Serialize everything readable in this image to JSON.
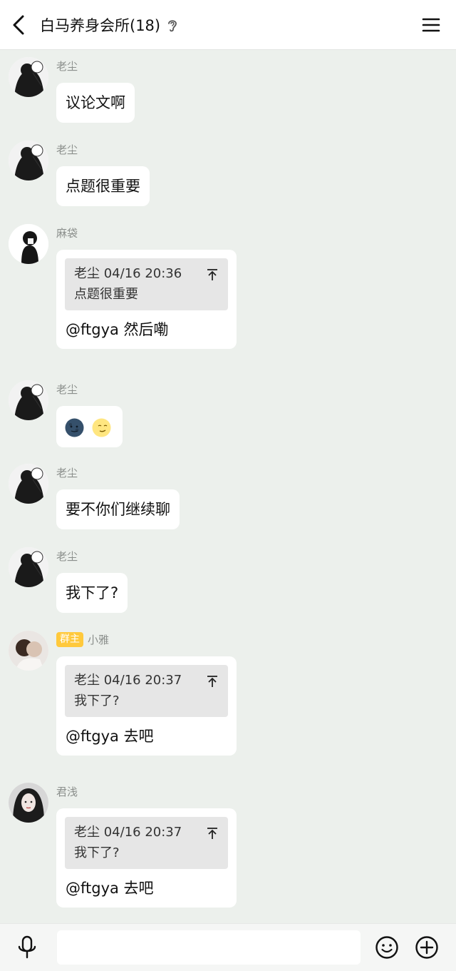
{
  "header": {
    "title": "白马养身会所(18)",
    "back_icon": "back-arrow-icon",
    "ear_icon": "ear-icon",
    "menu_icon": "menu-icon"
  },
  "messages": [
    {
      "sender": "老尘",
      "text": "议论文啊"
    },
    {
      "sender": "老尘",
      "text": "点题很重要"
    },
    {
      "sender": "麻袋",
      "quote_author": "老尘",
      "quote_time": "04/16 20:36",
      "quote_text": "点题很重要",
      "text": "@ftgya 然后嘞"
    },
    {
      "sender": "老尘",
      "emojis": [
        "new-moon-face-emoji",
        "first-quarter-moon-face-emoji"
      ]
    },
    {
      "sender": "老尘",
      "text": "要不你们继续聊"
    },
    {
      "sender": "老尘",
      "text": "我下了?"
    },
    {
      "sender": "小雅",
      "badge": "群主",
      "quote_author": "老尘",
      "quote_time": "04/16 20:37",
      "quote_text": "我下了?",
      "text": "@ftgya 去吧"
    },
    {
      "sender": "君浅",
      "quote_author": "老尘",
      "quote_time": "04/16 20:37",
      "quote_text": "我下了?",
      "text": "@ftgya 去吧"
    }
  ],
  "footer": {
    "input_value": "",
    "voice_icon": "microphone-icon",
    "emoji_icon": "smiley-icon",
    "plus_icon": "plus-circle-icon"
  },
  "colors": {
    "background": "#ecf0ec",
    "bubble": "#ffffff",
    "quote_bg": "#e6e6e6",
    "badge": "#ffc93c",
    "sender_text": "#8b8f8c"
  }
}
